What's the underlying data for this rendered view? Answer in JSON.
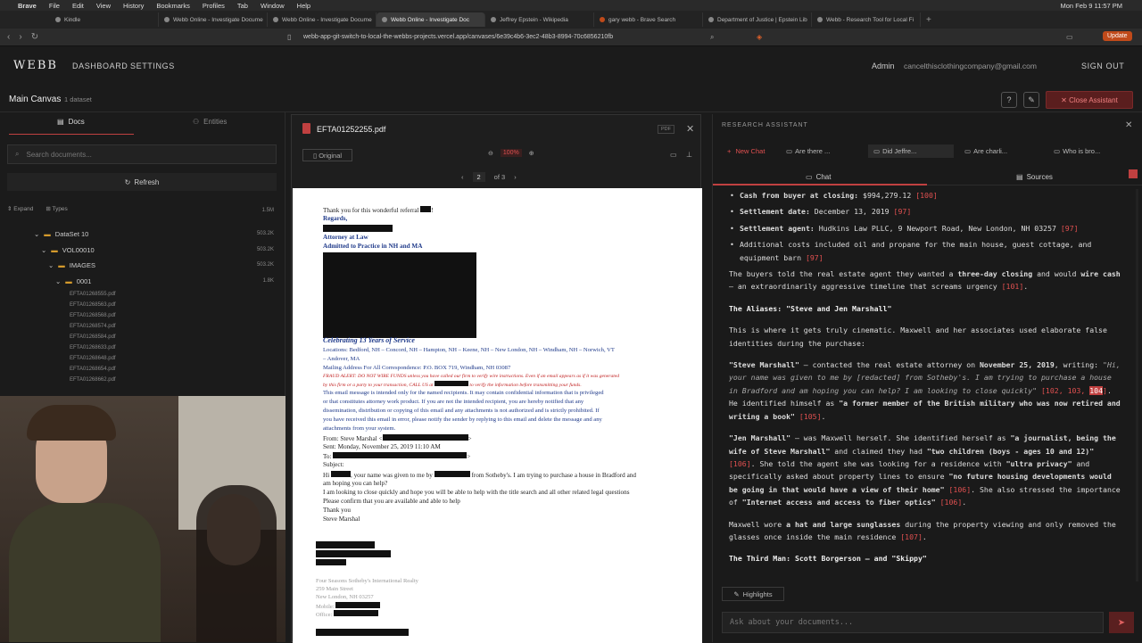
{
  "system": {
    "apple": "",
    "app": "Brave",
    "menus": [
      "File",
      "Edit",
      "View",
      "History",
      "Bookmarks",
      "Profiles",
      "Tab",
      "Window",
      "Help"
    ],
    "clock": "Mon Feb 9  11:57 PM"
  },
  "tabs": [
    "Kindle",
    "Webb Online - Investigate Docume",
    "Webb Online - Investigate Docume",
    "Webb Online - Investigate Doc",
    "Jeffrey Epstein - Wikipedia",
    "gary webb - Brave Search",
    "Department of Justice | Epstein Lib",
    "Webb - Research Tool for Local Fi"
  ],
  "browser": {
    "url": "webb-app-git-switch-to-local-the-webbs-projects.vercel.app/canvases/6e39c4b6-3ec2-48b3-8994-70c6856210fb",
    "update": "Update"
  },
  "header": {
    "logo": "WEBB",
    "nav": [
      "DASHBOARD",
      "SETTINGS"
    ],
    "admin": "Admin",
    "email": "cancelthisclothingcompany@gmail.com",
    "signout": "SIGN OUT"
  },
  "canvas": {
    "title": "Main Canvas",
    "count": "1 dataset",
    "close_assistant": "Close Assistant"
  },
  "left": {
    "tab_docs": "Docs",
    "tab_entities": "Entities",
    "search_placeholder": "Search documents...",
    "refresh": "Refresh",
    "expand": "Expand",
    "types": "Types",
    "root_size": "1.5M",
    "tree": [
      {
        "label": "DataSet 10",
        "size": "503.2K"
      },
      {
        "label": "VOL00010",
        "size": "503.2K"
      },
      {
        "label": "IMAGES",
        "size": "503.2K"
      },
      {
        "label": "0001",
        "size": "1.8K"
      }
    ],
    "files": [
      "EFTA01268555.pdf",
      "EFTA01268563.pdf",
      "EFTA01268568.pdf",
      "EFTA01268574.pdf",
      "EFTA01268584.pdf",
      "EFTA01268633.pdf",
      "EFTA01268648.pdf",
      "EFTA01268654.pdf",
      "EFTA01268662.pdf"
    ]
  },
  "pdf": {
    "filename": "EFTA01252255.pdf",
    "badge": "PDF",
    "original": "Original",
    "zoom": "100%",
    "page": "2",
    "of": "of 3",
    "lines": [
      "Thank you for this wonderful referral",
      "Regards,",
      "Attorney at Law",
      "Admitted to Practice in NH and MA",
      "Celebrating 13 Years of Service",
      "Locations: Bedford, NH – Concord, NH – Hampton, NH – Keene, NH – New London, NH – Windham, NH – Norwich, VT",
      "– Andover, MA",
      "Mailing Address For All Correspondence: P.O. BOX 719, Windham, NH 03087",
      "FRAUD ALERT: DO NOT WIRE FUNDS unless you have called our firm to verify wire instructions. Even if an email appears as if it was generated",
      "by this firm or a party to your transaction, CALL US at",
      "to verify the information before transmitting your funds.",
      "This email message is intended only for the named recipients. It may contain confidential information that is privileged",
      "or that constitutes attorney work product. If you are not the intended recipient, you are hereby notified that any",
      "dissemination, distribution or copying of this email and any attachments is not authorized and is strictly prohibited. If",
      "you have received this email in error, please notify the sender by replying to this email and delete the message and any",
      "attachments from your system.",
      "From: Steve Marshal <",
      "Sent: Monday, November 25, 2019 11:10 AM",
      "To:",
      "Subject:",
      "Hi",
      ", your name was given to me by",
      "from Sotheby's. I am trying to purchase a house in Bradford and",
      "am hoping you can help?",
      "I am looking to close quickly and hope you will be able to help with the title search and all other related legal questions",
      "Please confirm that you are available and able to help",
      "Thank you",
      "Steve Marshal",
      "Four Seasons Sotheby's International Realty",
      "259 Main Street",
      "New London, NH 03257",
      "Mobile:",
      "Office:"
    ]
  },
  "assistant": {
    "title": "RESEARCH ASSISTANT",
    "new_chat": "New Chat",
    "chats": [
      "Are there ...",
      "Did Jeffre...",
      "Are charli...",
      "Who is bro..."
    ],
    "tab_chat": "Chat",
    "tab_sources": "Sources",
    "highlights": "Highlights",
    "ask_placeholder": "Ask about your documents..."
  }
}
